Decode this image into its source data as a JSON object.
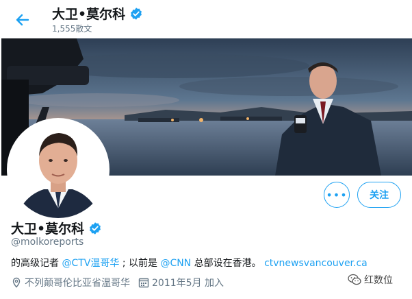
{
  "header": {
    "back_icon": "arrow-left-icon",
    "title": "大卫•莫尔科",
    "post_count": "1,555散文"
  },
  "profile": {
    "display_name": "大卫•莫尔科",
    "handle": "@molkoreports",
    "more_label": "•••",
    "follow_label": "关注",
    "bio": {
      "part1": "的高级记者 ",
      "mention1": "@CTV温哥华",
      "part2": "; 以前是",
      "mention2": "@CNN",
      "part3": "总部设在香港。 ",
      "link": "ctvnewsvancouver.ca"
    },
    "location": "不列颠哥伦比亚省温哥华",
    "joined": "2011年5月 加入"
  },
  "watermark": {
    "text": "红数位",
    "icon": "wechat-icon"
  },
  "colors": {
    "accent": "#1da1f2",
    "secondary_text": "#657786",
    "text": "#14171a"
  }
}
